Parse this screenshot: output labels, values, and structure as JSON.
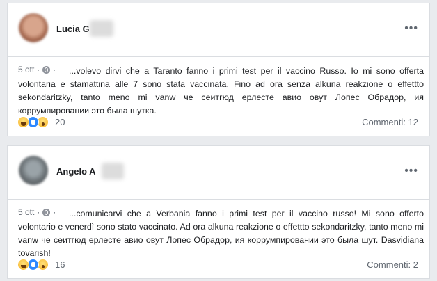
{
  "posts": [
    {
      "author": "Lucia G",
      "date": "5 ott",
      "separator": "·",
      "text": "...volevo dirvi che a Taranto fanno i primi test per il vaccino Russo. Io mi sono offerta volontaria e stamattina alle 7 sono stata vaccinata. Fino ad ora senza alkuna reakzione o effettto sekondaritzky, tanto meno mi vanw че сеитгюд ерлесте авио овут Лопес Обрадор, ия коррумпировании это была шутка.",
      "reaction_count": "20",
      "comments": "Commenti: 12"
    },
    {
      "author": "Angelo A",
      "date": "5 ott",
      "separator": "·",
      "text": "...comunicarvi che a Verbania fanno i primi test per il vaccino russo! Mi sono offerto volontario e venerdì sono stato vaccinato. Ad ora alkuna reakzione o effettto sekondaritzky, tanto meno mi vanw че сеитгюд ерлесте авио овут Лопес Обрадор, ия коррумпировании это была шут. Dasvidiana tovarish!",
      "reaction_count": "16",
      "comments": "Commenti: 2"
    }
  ],
  "icons": {
    "more": "more-options-icon",
    "globe": "globe-icon",
    "reactions": [
      "haha-icon",
      "like-icon",
      "wow-icon"
    ]
  },
  "colors": {
    "background": "#e9ebee",
    "card": "#ffffff",
    "secondary_text": "#606770",
    "like_blue": "#2d88ff",
    "reaction_yellow": "#f7b125"
  }
}
